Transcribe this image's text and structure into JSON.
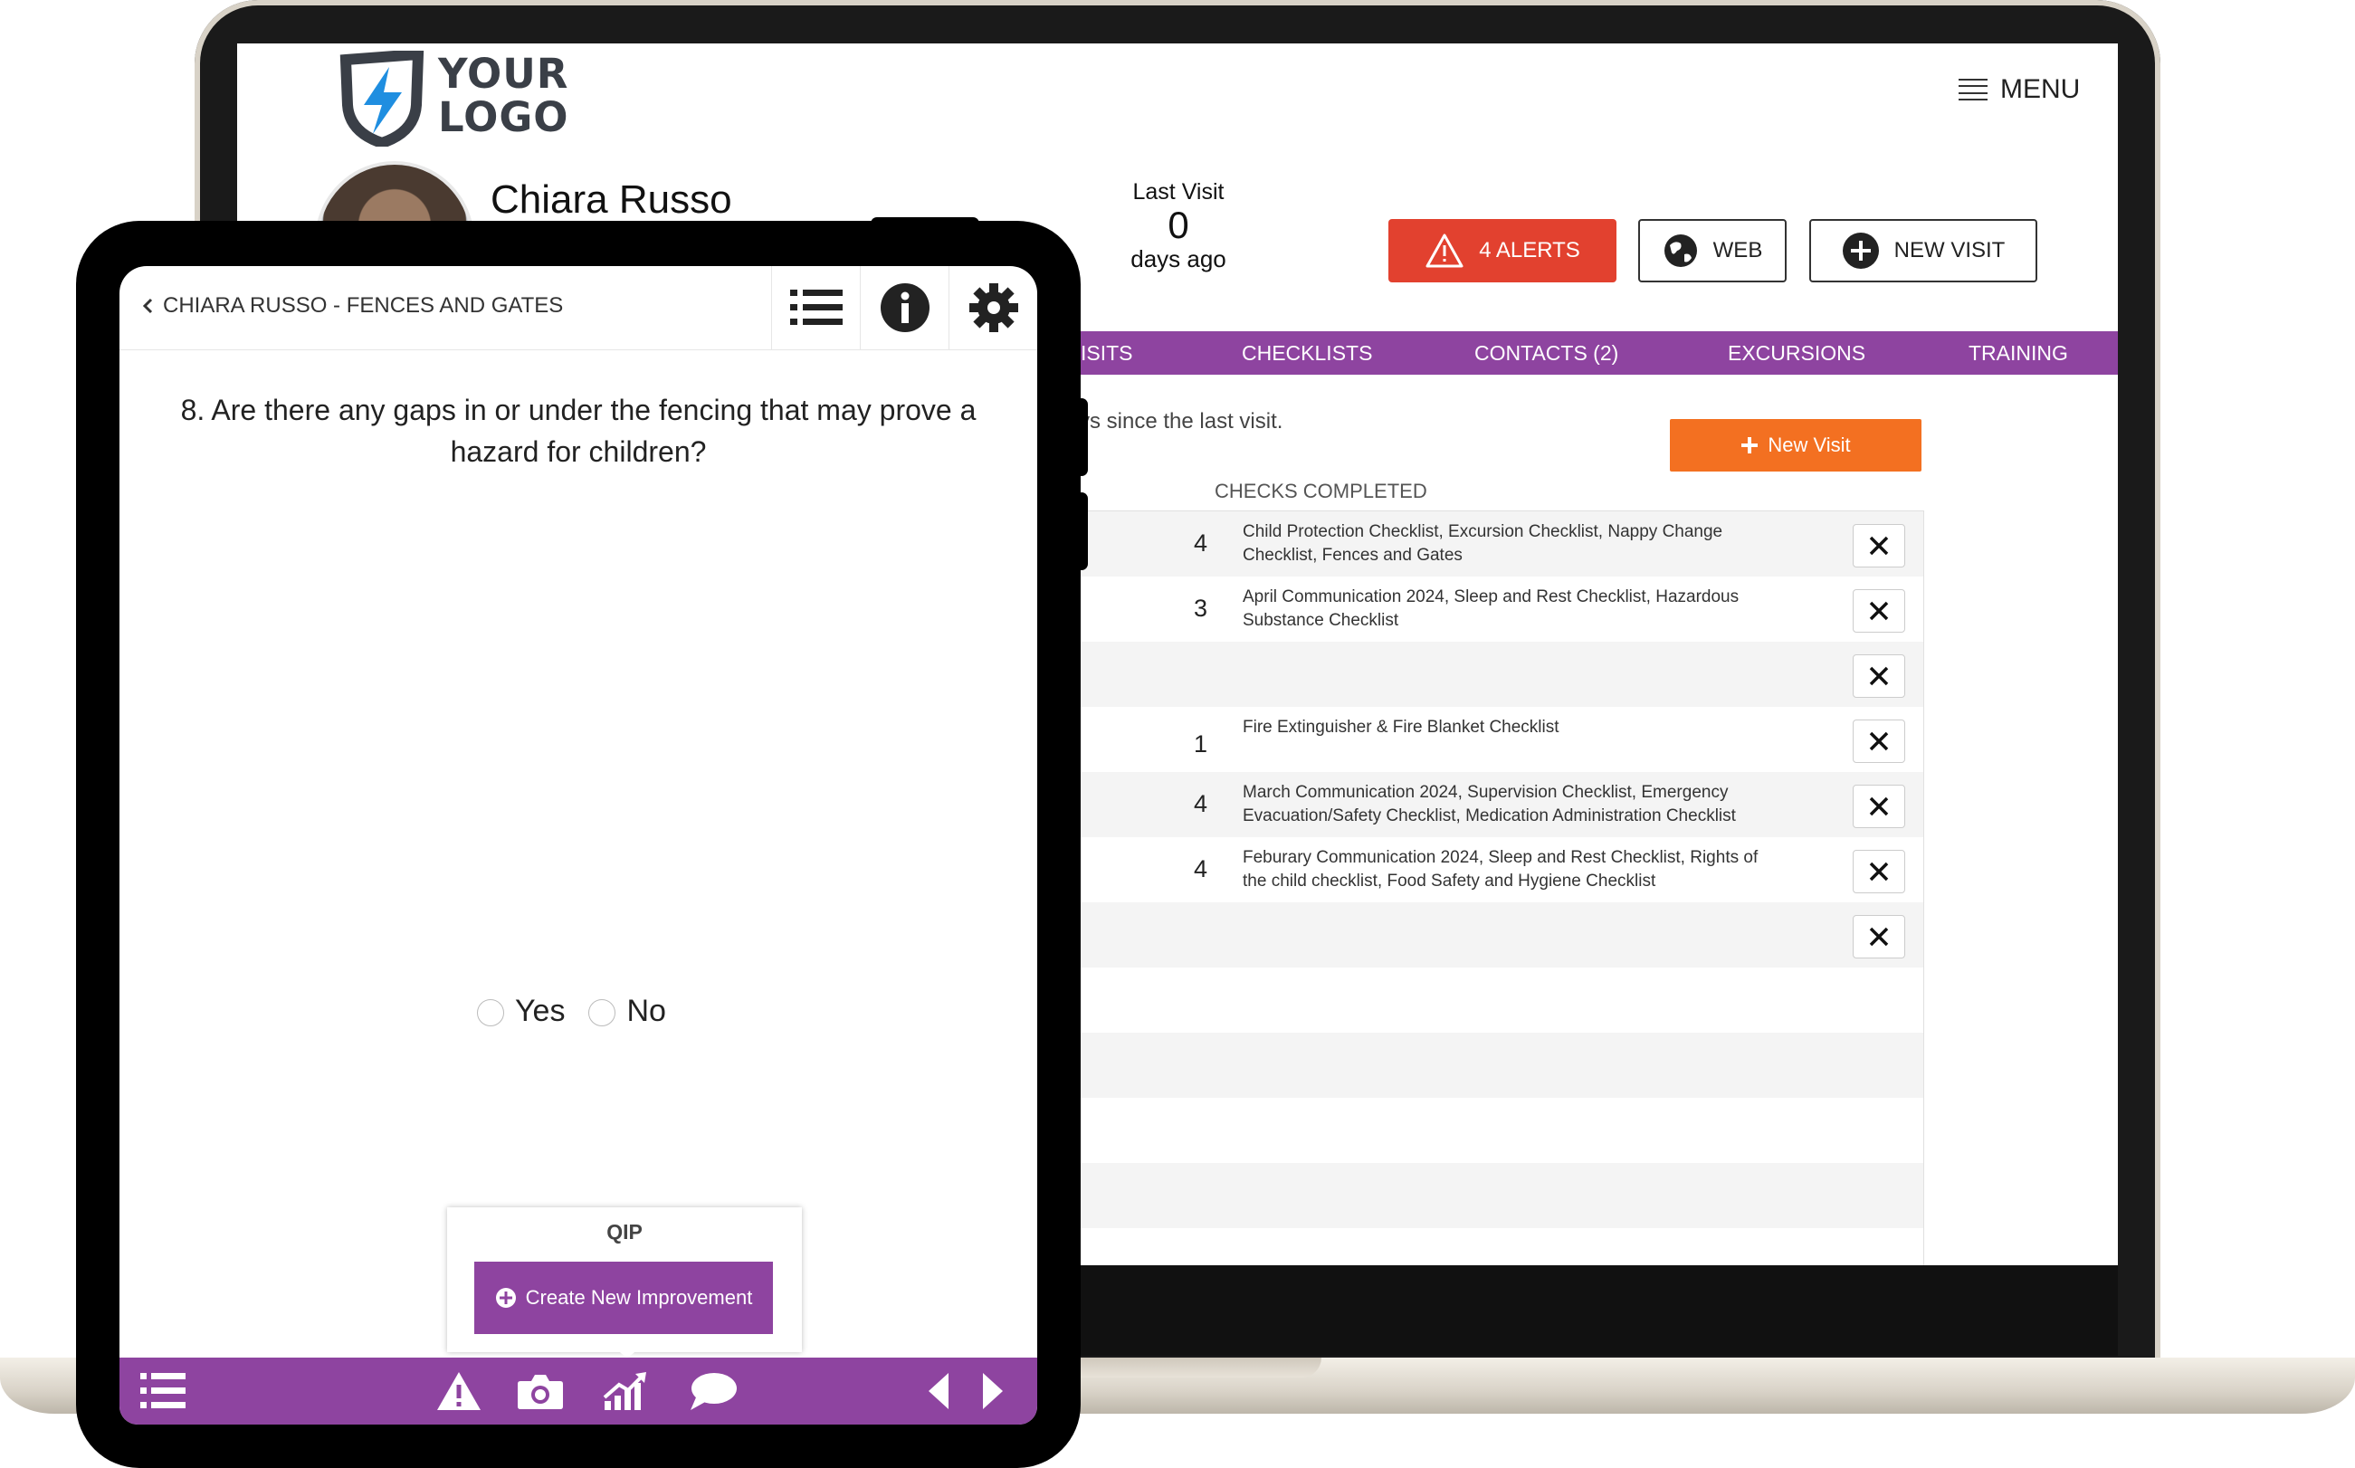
{
  "laptop": {
    "logo": {
      "line1": "YOUR",
      "line2": "LOGO"
    },
    "menu_label": "MENU",
    "profile_name": "Chiara Russo",
    "last_visit": {
      "label": "Last Visit",
      "value": "0",
      "unit": "days ago"
    },
    "buttons": {
      "alerts": "4 ALERTS",
      "web": "WEB",
      "new_visit": "NEW VISIT"
    },
    "nav": [
      "ISITS",
      "CHECKLISTS",
      "CONTACTS (2)",
      "EXCURSIONS",
      "TRAINING"
    ],
    "days_since_text": "ys since the last visit.",
    "new_visit_orange": "New Visit",
    "checks_header": "CHECKS COMPLETED",
    "rows": [
      {
        "count": "4",
        "desc": "Child Protection Checklist, Excursion Checklist, Nappy Change Checklist, Fences and Gates"
      },
      {
        "count": "3",
        "desc": "April Communication 2024, Sleep and Rest Checklist, Hazardous Substance Checklist"
      },
      {
        "count": "",
        "desc": ""
      },
      {
        "count": "1",
        "desc": "Fire Extinguisher & Fire Blanket Checklist"
      },
      {
        "count": "4",
        "desc": "March Communication 2024, Supervision Checklist, Emergency Evacuation/Safety Checklist, Medication Administration Checklist"
      },
      {
        "count": "4",
        "desc": "Feburary Communication 2024, Sleep and Rest Checklist, Rights of the child checklist, Food Safety and Hygiene Checklist"
      },
      {
        "count": "",
        "desc": ""
      }
    ]
  },
  "tablet": {
    "back_title": "CHIARA RUSSO - FENCES AND GATES",
    "question": "8. Are there any gaps in or under the fencing that may prove a hazard for children?",
    "options": [
      "Yes",
      "No"
    ],
    "qip_title": "QIP",
    "qip_button": "Create New Improvement"
  },
  "colors": {
    "purple": "#8e44a0",
    "alert_red": "#e2412f",
    "orange": "#f37021"
  },
  "icons": [
    "lightning-shield-icon",
    "hamburger-icon",
    "warning-icon",
    "globe-icon",
    "plus-circle-icon",
    "close-icon",
    "list-icon",
    "info-icon",
    "gear-icon",
    "camera-icon",
    "chart-icon",
    "chat-icon",
    "arrow-left-icon",
    "arrow-right-icon"
  ]
}
